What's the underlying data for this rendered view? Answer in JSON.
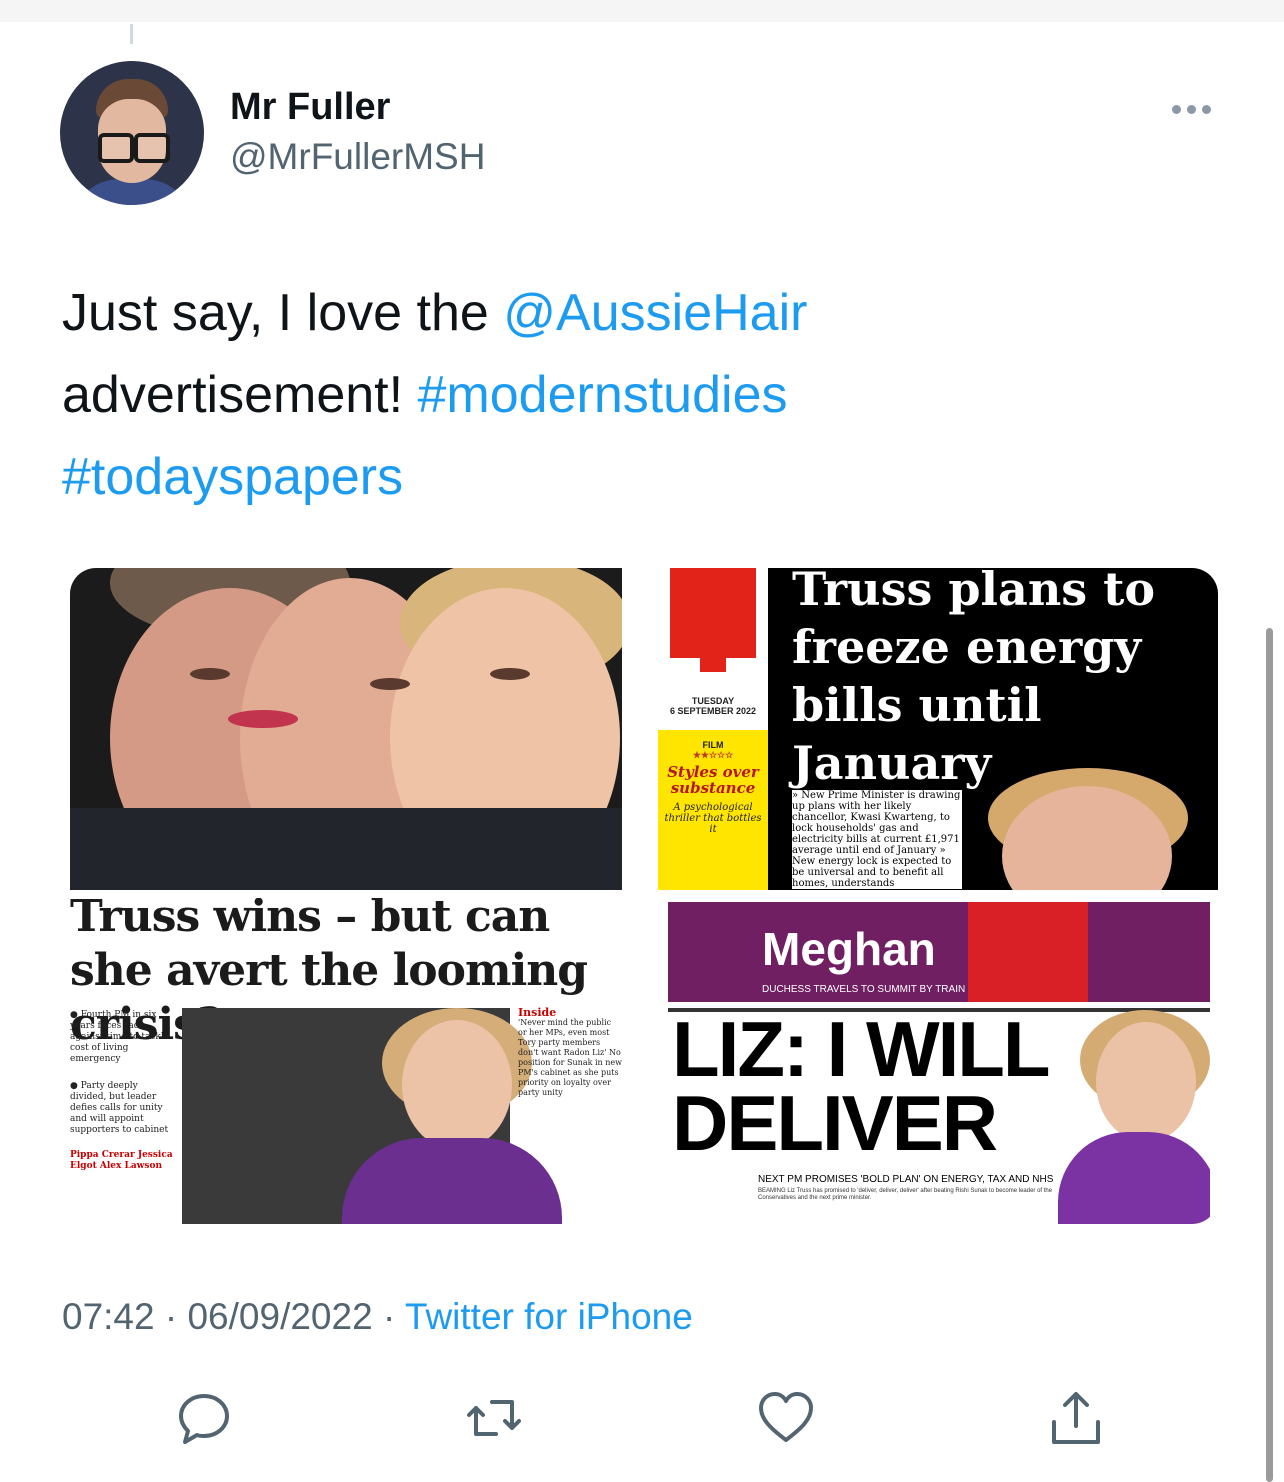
{
  "tweet": {
    "author_name": "Mr Fuller",
    "author_handle": "@MrFullerMSH",
    "text_before": "Just say, I love the ",
    "mention": "@AussieHair",
    "text_middle": " advertisement! ",
    "hashtag1": "#modernstudies",
    "hashtag2": "#todayspapers",
    "time": "07:42",
    "separator": " · ",
    "date": "06/09/2022",
    "client": "Twitter for iPhone"
  },
  "papers": {
    "i_date_line1": "TUESDAY",
    "i_date_line2": "6 SEPTEMBER 2022",
    "i_film": "FILM",
    "i_stars": "★★☆☆☆",
    "i_feature_title": "Styles over substance",
    "i_feature_sub": "A psychological thriller that bottles it",
    "i_headline": "Truss plans to freeze energy bills until January",
    "i_body": "» New Prime Minister is drawing up plans with her likely chancellor, Kwasi Kwarteng, to lock households' gas and electricity bills at current £1,971 average until end of January  » New energy lock is expected to be universal and to benefit all homes, understands",
    "guardian_headline": "Truss wins – but can she avert the looming crisis?",
    "guardian_col1": "● Fourth PM in six years faces race against time to tackle cost of living emergency",
    "guardian_col2": "● Party deeply divided, but leader defies calls for unity and will appoint supporters to cabinet",
    "guardian_byline": "Pippa Crerar  Jessica Elgot  Alex Lawson",
    "guardian_inside_title": "Inside",
    "guardian_inside_text": "'Never mind the public or her MPs, even most Tory party members don't want Radon Liz'  No position for Sunak in new PM's cabinet as she puts priority on loyalty over party unity",
    "metro_top": "Meghan",
    "metro_top_sub": "DUCHESS TRAVELS TO SUMMIT BY TRAIN",
    "metro_headline_1": "LIZ: I WILL",
    "metro_headline_2": "DELIVER",
    "metro_sub": "NEXT PM PROMISES 'BOLD PLAN' ON ENERGY, TAX AND NHS",
    "metro_body": "BEAMING Liz Truss has promised to 'deliver, deliver, deliver' after beating Rishi Sunak to become leader of the Conservatives and the next prime minister."
  },
  "colors": {
    "link": "#1d9bf0",
    "secondary_text": "#536471",
    "primary_text": "#0f1419"
  },
  "icons": [
    "reply-icon",
    "retweet-icon",
    "like-icon",
    "share-icon",
    "more-options-icon"
  ]
}
